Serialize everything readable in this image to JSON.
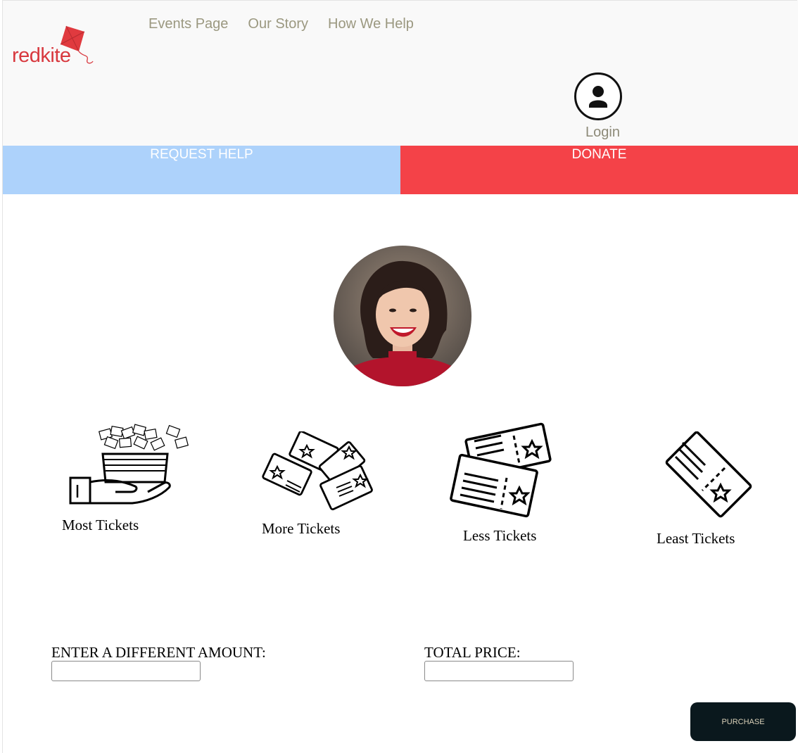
{
  "brand": {
    "logo_text": "redkite"
  },
  "nav": {
    "items": [
      "Events Page",
      "Our Story",
      "How We Help"
    ]
  },
  "account": {
    "login_label": "Login"
  },
  "actions": {
    "request_help": "REQUEST HELP",
    "donate": "DONATE"
  },
  "ticket_options": [
    {
      "label": "Most Tickets",
      "icon": "hand-with-tickets-icon"
    },
    {
      "label": "More Tickets",
      "icon": "many-tickets-icon"
    },
    {
      "label": "Less Tickets",
      "icon": "two-tickets-icon"
    },
    {
      "label": "Least Tickets",
      "icon": "single-ticket-icon"
    }
  ],
  "form": {
    "amount_label": "ENTER A DIFFERENT AMOUNT:",
    "amount_value": "",
    "total_label": "TOTAL PRICE:",
    "total_value": ""
  },
  "purchase_label": "PURCHASE",
  "colors": {
    "brand_red": "#d8383e",
    "donate_red": "#f44248",
    "help_blue": "#add2fb",
    "purchase_dark": "#0a181d"
  }
}
